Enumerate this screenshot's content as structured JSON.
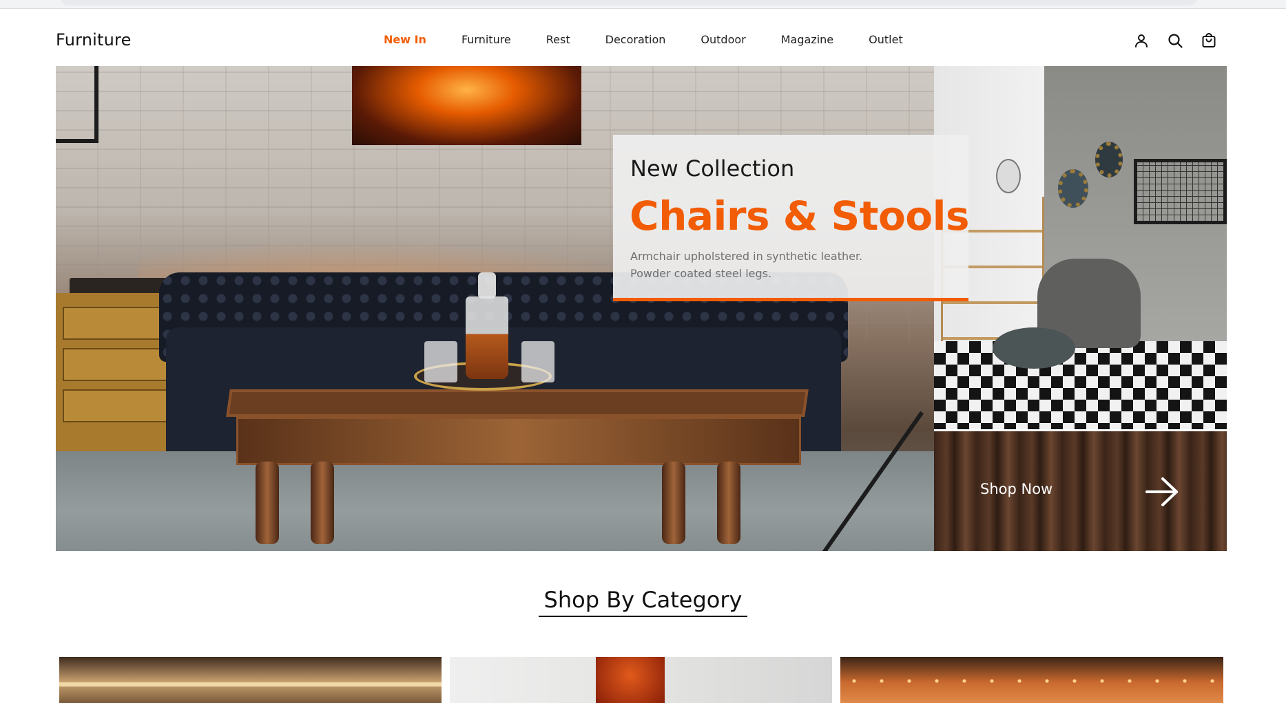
{
  "header": {
    "logo": "Furniture",
    "nav": [
      {
        "label": "New In",
        "active": true
      },
      {
        "label": "Furniture",
        "active": false
      },
      {
        "label": "Rest",
        "active": false
      },
      {
        "label": "Decoration",
        "active": false
      },
      {
        "label": "Outdoor",
        "active": false
      },
      {
        "label": "Magazine",
        "active": false
      },
      {
        "label": "Outlet",
        "active": false
      }
    ],
    "icons": [
      "user-icon",
      "search-icon",
      "shopping-bag-icon"
    ]
  },
  "hero": {
    "kicker": "New Collection",
    "headline": "Chairs & Stools",
    "description_line1": "Armchair upholstered in synthetic leather.",
    "description_line2": "Powder coated steel legs.",
    "cta": "Shop Now",
    "cta_icon": "arrow-right-icon"
  },
  "category": {
    "title": "Shop By Category"
  },
  "colors": {
    "accent": "#f25c05",
    "text": "#111111",
    "muted": "#707070"
  }
}
